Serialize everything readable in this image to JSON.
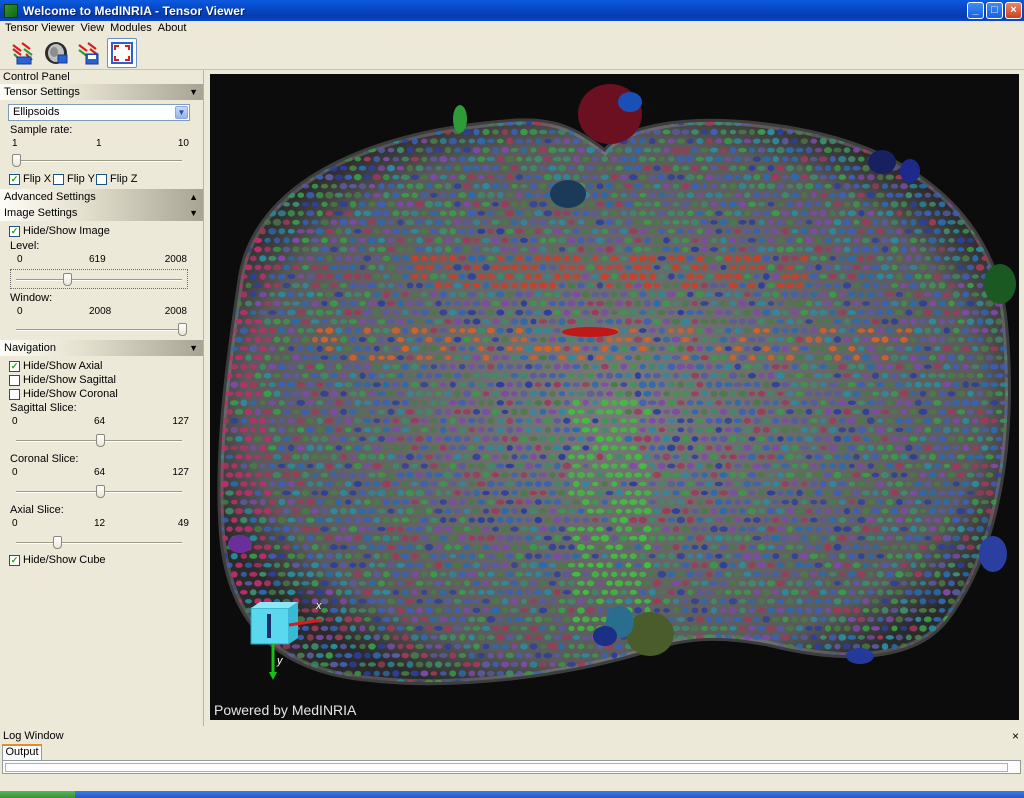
{
  "window": {
    "title": "Welcome to MedINRIA - Tensor Viewer",
    "buttons": [
      "_",
      "□",
      "×"
    ]
  },
  "menu": [
    "Tensor Viewer",
    "View",
    "Modules",
    "About"
  ],
  "toolbar": {
    "icons": [
      "open-tensor-icon",
      "brain-icon",
      "save-tensor-icon",
      "fullscreen-icon"
    ]
  },
  "control_panel": {
    "title": "Control Panel",
    "tensor_settings": {
      "header": "Tensor Settings",
      "shape_selected": "Ellipsoids",
      "sample_rate_label": "Sample rate:",
      "sample_rate_min": "1",
      "sample_rate_value": "1",
      "sample_rate_max": "10",
      "sample_rate_fraction": 0.0,
      "flip_x_label": "Flip X",
      "flip_y_label": "Flip Y",
      "flip_z_label": "Flip Z",
      "flip_x": true,
      "flip_y": false,
      "flip_z": false
    },
    "advanced_settings": {
      "header": "Advanced Settings"
    },
    "image_settings": {
      "header": "Image Settings",
      "hide_show_image_label": "Hide/Show Image",
      "hide_show_image": true,
      "level_label": "Level:",
      "level_min": "0",
      "level_value": "619",
      "level_max": "2008",
      "level_fraction": 0.308,
      "window_label": "Window:",
      "window_min": "0",
      "window_value": "2008",
      "window_max": "2008",
      "window_fraction": 1.0
    },
    "navigation": {
      "header": "Navigation",
      "axial_label": "Hide/Show Axial",
      "sagittal_label": "Hide/Show Sagittal",
      "coronal_label": "Hide/Show Coronal",
      "axial": true,
      "sagittal": false,
      "coronal": false,
      "sagittal_slice_label": "Sagittal Slice:",
      "sagittal_min": "0",
      "sagittal_value": "64",
      "sagittal_max": "127",
      "sagittal_fraction": 0.504,
      "coronal_slice_label": "Coronal Slice:",
      "coronal_min": "0",
      "coronal_value": "64",
      "coronal_max": "127",
      "coronal_fraction": 0.504,
      "axial_slice_label": "Axial Slice:",
      "axial_min": "0",
      "axial_value": "12",
      "axial_max": "49",
      "axial_fraction": 0.245,
      "cube_label": "Hide/Show Cube",
      "cube": true
    }
  },
  "viewer": {
    "watermark": "Powered by MedINRIA",
    "axis_x_label": "x",
    "axis_y_label": "y",
    "background": "#0c0c0c"
  },
  "log": {
    "title": "Log Window",
    "close": "×",
    "tab": "Output"
  }
}
